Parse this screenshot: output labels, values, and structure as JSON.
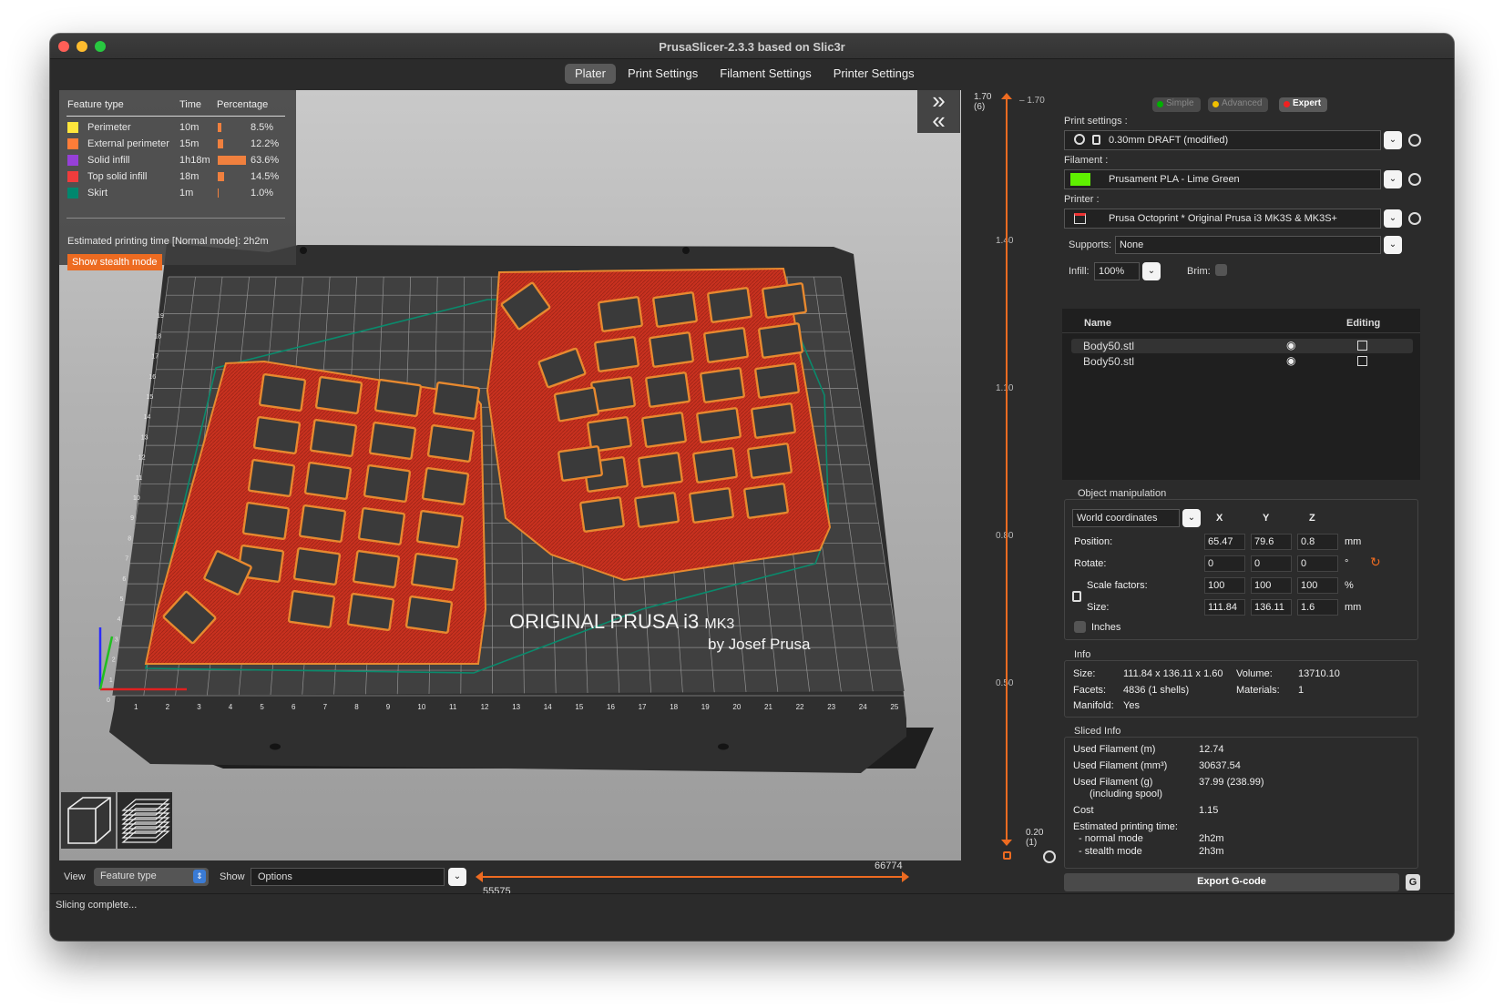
{
  "window": {
    "title": "PrusaSlicer-2.3.3 based on Slic3r"
  },
  "tabs": [
    {
      "label": "Plater",
      "active": true
    },
    {
      "label": "Print Settings",
      "active": false
    },
    {
      "label": "Filament Settings",
      "active": false
    },
    {
      "label": "Printer Settings",
      "active": false
    }
  ],
  "legend": {
    "headers": {
      "type": "Feature type",
      "time": "Time",
      "pct": "Percentage"
    },
    "rows": [
      {
        "name": "Perimeter",
        "time": "10m",
        "pct": "8.5%",
        "fraction": 0.085,
        "color": "#ffe63c"
      },
      {
        "name": "External perimeter",
        "time": "15m",
        "pct": "12.2%",
        "fraction": 0.122,
        "color": "#ff7d38"
      },
      {
        "name": "Solid infill",
        "time": "1h18m",
        "pct": "63.6%",
        "fraction": 0.636,
        "color": "#9640d8"
      },
      {
        "name": "Top solid infill",
        "time": "18m",
        "pct": "14.5%",
        "fraction": 0.145,
        "color": "#f03c3c"
      },
      {
        "name": "Skirt",
        "time": "1m",
        "pct": "1.0%",
        "fraction": 0.01,
        "color": "#00876e"
      }
    ],
    "estimated": "Estimated printing time [Normal mode]:  2h2m",
    "stealth_button": "Show stealth mode"
  },
  "bed": {
    "brand_line1": "ORIGINAL PRUSA i3",
    "brand_mk": "MK3",
    "brand_line2": "by Josef Prusa",
    "x_ticks": [
      "1",
      "2",
      "3",
      "4",
      "5",
      "6",
      "7",
      "8",
      "9",
      "10",
      "11",
      "12",
      "13",
      "14",
      "15",
      "16",
      "17",
      "18",
      "19",
      "20",
      "21",
      "22",
      "23",
      "24",
      "25"
    ],
    "y_ticks": [
      "0",
      "1",
      "2",
      "3",
      "4",
      "5",
      "6",
      "7",
      "8",
      "9",
      "10",
      "11",
      "12",
      "13",
      "14",
      "15",
      "16",
      "17",
      "18",
      "19"
    ]
  },
  "bottom": {
    "view_label": "View",
    "view_value": "Feature type",
    "show_label": "Show",
    "show_value": "Options",
    "h_max": "66774",
    "h_min": "55575"
  },
  "vslider": {
    "top_value": "1.70",
    "top_layer": "(6)",
    "top_tick": "1.70",
    "bottom_value": "0.20",
    "bottom_layer": "(1)",
    "ticks": [
      "1.40",
      "1.10",
      "0.80",
      "0.50"
    ]
  },
  "modes": {
    "simple": "Simple",
    "advanced": "Advanced",
    "expert": "Expert"
  },
  "sidebar": {
    "print_label": "Print settings :",
    "print_value": "0.30mm DRAFT (modified)",
    "filament_label": "Filament :",
    "filament_value": "Prusament PLA - Lime Green",
    "filament_color": "#5ff000",
    "printer_label": "Printer :",
    "printer_value": "Prusa Octoprint * Original Prusa i3 MK3S & MK3S+",
    "supports_label": "Supports:",
    "supports_value": "None",
    "infill_label": "Infill:",
    "infill_value": "100%",
    "brim_label": "Brim:",
    "list_name": "Name",
    "list_editing": "Editing",
    "objects": [
      "Body50.stl",
      "Body50.stl"
    ]
  },
  "manip": {
    "title": "Object manipulation",
    "coords": "World coordinates",
    "x": "X",
    "y": "Y",
    "z": "Z",
    "position_label": "Position:",
    "position": [
      "65.47",
      "79.6",
      "0.8"
    ],
    "position_unit": "mm",
    "rotate_label": "Rotate:",
    "rotate": [
      "0",
      "0",
      "0"
    ],
    "rotate_unit": "°",
    "scale_label": "Scale factors:",
    "scale": [
      "100",
      "100",
      "100"
    ],
    "scale_unit": "%",
    "size_label": "Size:",
    "size": [
      "111.84",
      "136.11",
      "1.6"
    ],
    "size_unit": "mm",
    "inches_label": "Inches"
  },
  "info": {
    "title": "Info",
    "size_label": "Size:",
    "size": "111.84 x 136.11 x 1.60",
    "volume_label": "Volume:",
    "volume": "13710.10",
    "facets_label": "Facets:",
    "facets": "4836 (1 shells)",
    "materials_label": "Materials:",
    "materials": "1",
    "manifold_label": "Manifold:",
    "manifold": "Yes"
  },
  "sliced": {
    "title": "Sliced Info",
    "filament_m_label": "Used Filament (m)",
    "filament_m": "12.74",
    "filament_mm3_label": "Used Filament (mm³)",
    "filament_mm3": "30637.54",
    "filament_g_label": "Used Filament (g)",
    "filament_g_sub": "(including spool)",
    "filament_g": "37.99 (238.99)",
    "cost_label": "Cost",
    "cost": "1.15",
    "time_label": "Estimated printing time:",
    "normal_label": "- normal mode",
    "normal": "2h2m",
    "stealth_label": "- stealth mode",
    "stealth": "2h3m"
  },
  "export_button": "Export G-code",
  "status": "Slicing complete..."
}
